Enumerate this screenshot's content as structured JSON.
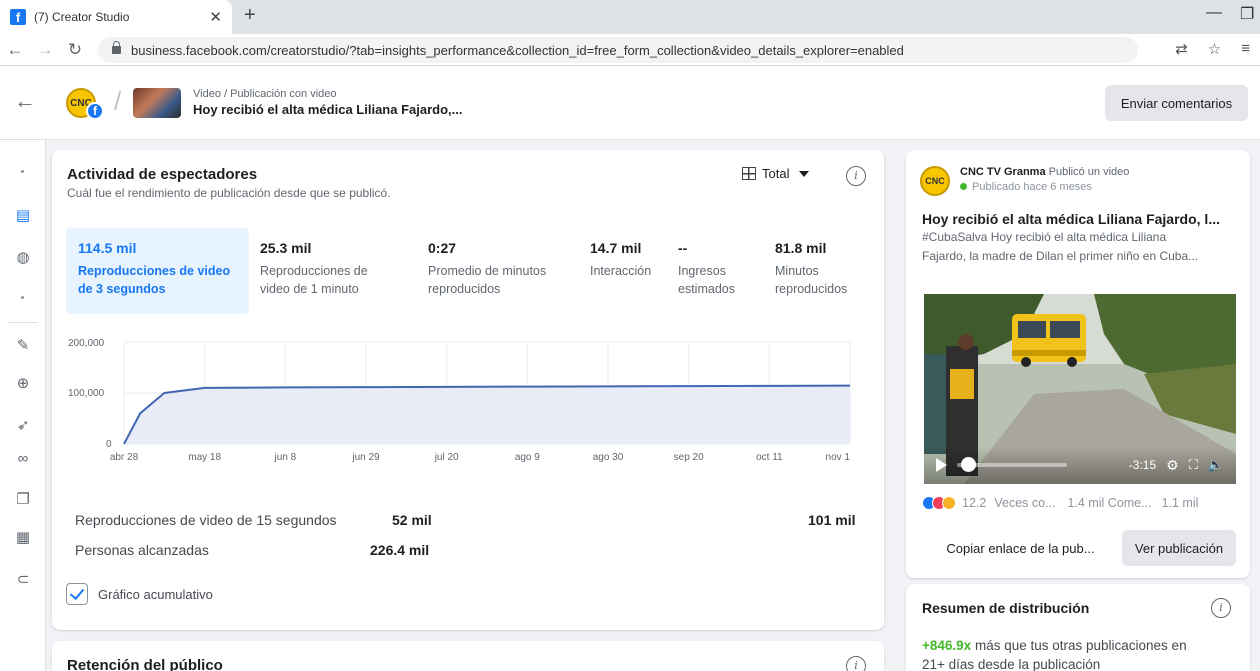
{
  "browser": {
    "tab_title": "(7) Creator Studio",
    "url": "business.facebook.com/creatorstudio/?tab=insights_performance&collection_id=free_form_collection&video_details_explorer=enabled"
  },
  "header": {
    "breadcrumb": "Video / Publicación con video",
    "video_title": "Hoy recibió el alta médica Liliana Fajardo,...",
    "feedback_button": "Enviar comentarios"
  },
  "activity": {
    "title": "Actividad de espectadores",
    "subtitle": "Cuál fue el rendimiento de publicación desde que se publicó.",
    "selector": "Total",
    "metrics": [
      {
        "value": "114.5 mil",
        "label1": "Reproducciones de video",
        "label2": "de 3 segundos"
      },
      {
        "value": "25.3 mil",
        "label1": "Reproducciones de",
        "label2": "video de 1 minuto"
      },
      {
        "value": "0:27",
        "label1": "Promedio de minutos",
        "label2": "reproducidos"
      },
      {
        "value": "14.7 mil",
        "label1": "Interacción",
        "label2": ""
      },
      {
        "value": "--",
        "label1": "Ingresos",
        "label2": "estimados"
      },
      {
        "value": "81.8 mil",
        "label1": "Minutos",
        "label2": "reproducidos"
      }
    ],
    "stats": [
      {
        "label": "Reproducciones de video de 15 segundos",
        "value": "52 mil",
        "value2": "101 mil"
      },
      {
        "label": "Personas alcanzadas",
        "value": "226.4 mil"
      }
    ],
    "cumulative_label": "Gráfico acumulativo"
  },
  "chart_data": {
    "type": "area",
    "categories": [
      "abr 28",
      "may 18",
      "jun 8",
      "jun 29",
      "jul 20",
      "ago 9",
      "ago 30",
      "sep 20",
      "oct 11",
      "nov 1"
    ],
    "x": [
      0,
      0.2,
      0.5,
      1,
      2,
      3,
      4,
      5,
      6,
      7,
      8,
      9
    ],
    "values": [
      0,
      60000,
      100000,
      110000,
      111000,
      111500,
      112000,
      112500,
      113000,
      113500,
      114000,
      114500
    ],
    "ylim": [
      0,
      200000
    ],
    "yticks": [
      "200,000",
      "100,000",
      "0"
    ],
    "grid": true,
    "line_color": "#4267b2",
    "fill_color": "#e7ecf7"
  },
  "retention": {
    "title": "Retención del público"
  },
  "post": {
    "page_name": "CNC TV Granma",
    "published_text": "Publicó un video",
    "published_ago": "Publicado hace 6 meses",
    "title": "Hoy recibió el alta médica Liliana Fajardo, l...",
    "description_line1": "#CubaSalva Hoy recibió el alta médica Liliana",
    "description_line2": "Fajardo, la madre de Dilan el primer niño en Cuba...",
    "time_remaining": "-3:15",
    "reaction_count": "12.2",
    "views": "Veces co...",
    "comments": "1.4 mil  Come...",
    "shares": "1.1 mil",
    "copy_link": "Copiar enlace de la pub...",
    "view_post": "Ver publicación",
    "logo_text": "CNC"
  },
  "distribution": {
    "title": "Resumen de distribución",
    "multiplier": "+846.9x",
    "text_line1": "más que tus otras publicaciones en",
    "text_line2": "21+ días desde la publicación"
  },
  "colors": {
    "accent": "#1877f2",
    "positive": "#42b72a"
  }
}
